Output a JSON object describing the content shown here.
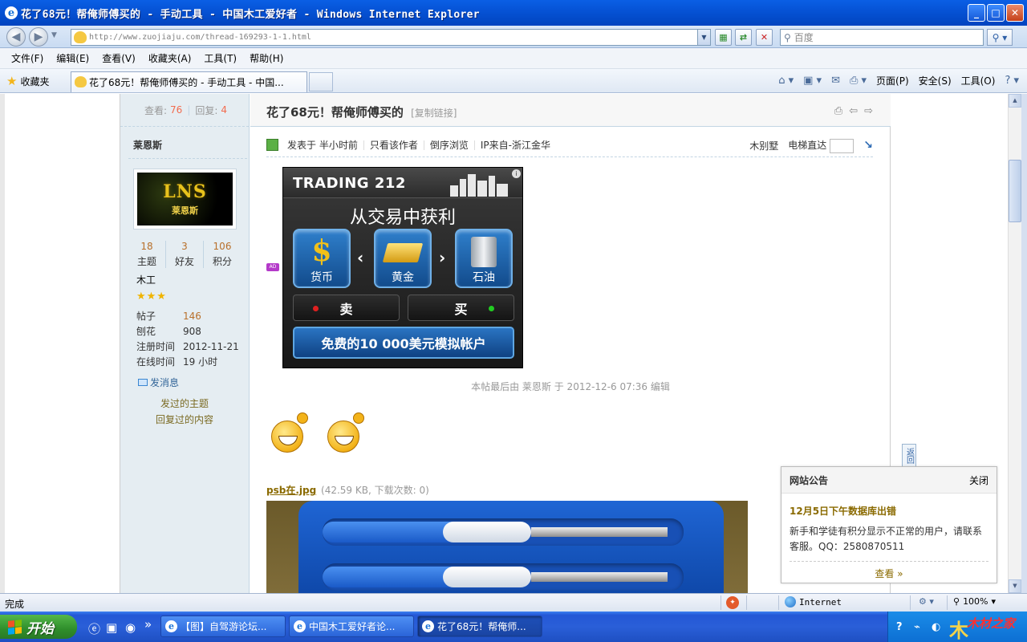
{
  "window": {
    "title": "花了68元！帮俺师傅买的 - 手动工具 - 中国木工爱好者 - Windows Internet Explorer",
    "ie_glyph": "e",
    "min_glyph": "_",
    "max_glyph": "□",
    "close_glyph": "✕"
  },
  "address": {
    "url": "http://www.zuojiaju.com/thread-169293-1-1.html",
    "search_placeholder": "百度"
  },
  "menu": [
    "文件(F)",
    "编辑(E)",
    "查看(V)",
    "收藏夹(A)",
    "工具(T)",
    "帮助(H)"
  ],
  "favorites_label": "收藏夹",
  "tab_title": "花了68元！帮俺师傅买的 - 手动工具 - 中国...",
  "command_bar": {
    "page": "页面(P)",
    "safety": "安全(S)",
    "tools": "工具(O)"
  },
  "sidebar": {
    "views_label": "查看:",
    "views": "76",
    "replies_label": "回复:",
    "replies": "4",
    "username": "莱恩斯",
    "avatar_text": "LNS",
    "avatar_caption": "莱恩斯",
    "counts": [
      {
        "value": "18",
        "label": "主题"
      },
      {
        "value": "3",
        "label": "好友"
      },
      {
        "value": "106",
        "label": "积分"
      }
    ],
    "rank": "木工",
    "stars": "★★★",
    "info": [
      {
        "k": "帖子",
        "v": "146"
      },
      {
        "k": "刨花",
        "v": "908"
      },
      {
        "k": "注册时间",
        "v": "2012-11-21"
      },
      {
        "k": "在线时间",
        "v": "19 小时"
      }
    ],
    "pm": "发消息",
    "link_threads": "发过的主题",
    "link_replies": "回复过的内容"
  },
  "post": {
    "title": "花了68元！帮俺师傅买的",
    "copy_link": "[复制链接]",
    "meta": [
      "发表于 半小时前",
      "只看该作者",
      "倒序浏览",
      "IP来自-浙江金华"
    ],
    "floor": "木别墅",
    "elevator": "电梯直达",
    "edited": "本帖最后由 莱恩斯 于 2012-12-6 07:36 编辑",
    "attachment_name": "psb在.jpg",
    "attachment_meta": "(42.59 KB, 下载次数: 0)"
  },
  "ad": {
    "tag": "AD",
    "brand": "TRADING 212",
    "headline": "从交易中获利",
    "tiles": [
      "货币",
      "黄金",
      "石油"
    ],
    "sell": "卖",
    "buy": "买",
    "cta": "免费的10 000美元模拟帐户"
  },
  "notice": {
    "header": "网站公告",
    "close": "关闭",
    "title": "12月5日下午数据库出错",
    "body": "新手和学徒有积分显示不正常的用户，请联系客服。QQ：2580870511",
    "more": "查看 »"
  },
  "back_top": "返回",
  "status": {
    "text": "完成",
    "zone": "Internet",
    "zoom": "100%"
  },
  "taskbar": {
    "start": "开始",
    "tasks": [
      "【图】自驾游论坛...",
      "中国木工爱好者论...",
      "花了68元！帮俺师..."
    ],
    "tray_logo": "木材之家"
  }
}
